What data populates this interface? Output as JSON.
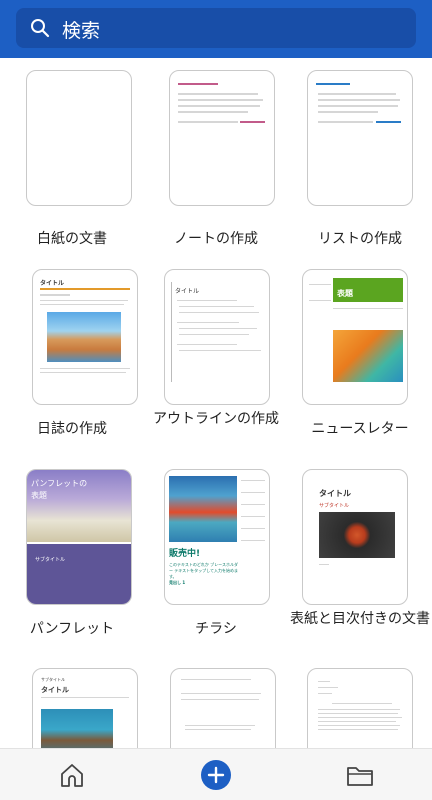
{
  "search": {
    "placeholder": "検索"
  },
  "templates": [
    {
      "label": "白紙の文書"
    },
    {
      "label": "ノートの作成"
    },
    {
      "label": "リストの作成"
    },
    {
      "label": "日誌の作成"
    },
    {
      "label": "アウトラインの作成"
    },
    {
      "label": "ニュースレター"
    },
    {
      "label": "パンフレット"
    },
    {
      "label": "チラシ"
    },
    {
      "label": "表紙と目次付きの文書"
    }
  ],
  "thumbnails": {
    "journal": {
      "title": "タイトル"
    },
    "outline": {
      "title": "タイトル"
    },
    "newsletter": {
      "title": "表題"
    },
    "pamphlet": {
      "title": "パンフレットの表題",
      "subtitle": "サブタイトル"
    },
    "flyer": {
      "headline": "販売中!",
      "body": "このテキストのどれか ブレースホルダー テキストをタップして入力を始めます。",
      "accent": "見出し 1"
    },
    "cover": {
      "title": "タイトル",
      "subtitle": "サブタイトル"
    },
    "row4_left": {
      "label": "サブタイトル",
      "title": "タイトル"
    }
  },
  "colors": {
    "topbar": "#1d5fc4",
    "accent": "#1d5fc4"
  }
}
